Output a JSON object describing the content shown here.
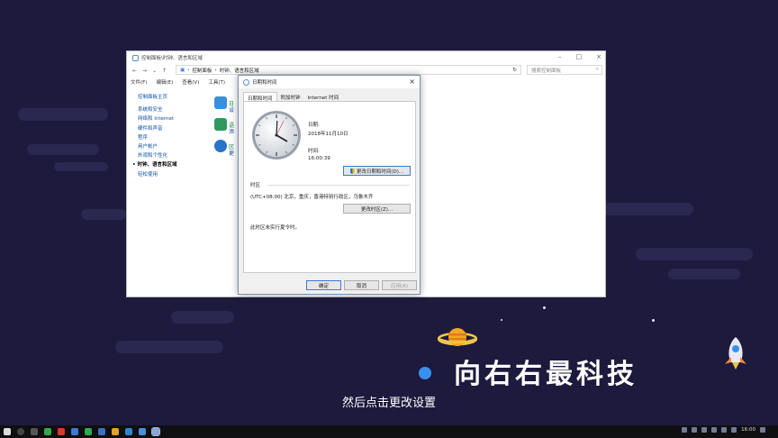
{
  "control_panel": {
    "title": "控制面板\\时钟、语言和区域",
    "breadcrumb": [
      "控制面板",
      "时钟、语言和区域"
    ],
    "search_placeholder": "搜索控制面板",
    "menu": [
      "文件(F)",
      "编辑(E)",
      "查看(V)",
      "工具(T)"
    ],
    "sidebar_home": "控制面板主页",
    "sidebar_items": [
      "系统和安全",
      "网络和 Internet",
      "硬件和声音",
      "程序",
      "用户帐户",
      "外观和个性化",
      "时钟、语言和区域",
      "轻松使用"
    ],
    "sidebar_current_index": 6,
    "icon_letters": [
      "日",
      "语",
      "区"
    ],
    "icon_sub": [
      "设",
      "添",
      "更"
    ]
  },
  "dialog": {
    "title": "日期和时间",
    "tabs": [
      "日期和时间",
      "附加时钟",
      "Internet 时间"
    ],
    "date_label": "日期:",
    "date_value": "2018年11月10日",
    "time_label": "时间:",
    "time_value": "16:00:39",
    "change_datetime_button": "更改日期和时间(D)...",
    "timezone_section": "时区",
    "timezone_value": "(UTC+08:00) 北京，重庆，香港特别行政区，乌鲁木齐",
    "change_timezone_button": "更改时区(Z)...",
    "dst_note": "此时区未实行夏令时。",
    "ok_button": "确定",
    "cancel_button": "取消",
    "apply_button": "应用(A)"
  },
  "brand": {
    "name": "向右右最科技"
  },
  "subtitle": "然后点击更改设置",
  "taskbar": {
    "clock": "16:00"
  },
  "colors": {
    "background": "#1d1a3d",
    "accent": "#3b78d8",
    "link": "#0f4fa8"
  }
}
